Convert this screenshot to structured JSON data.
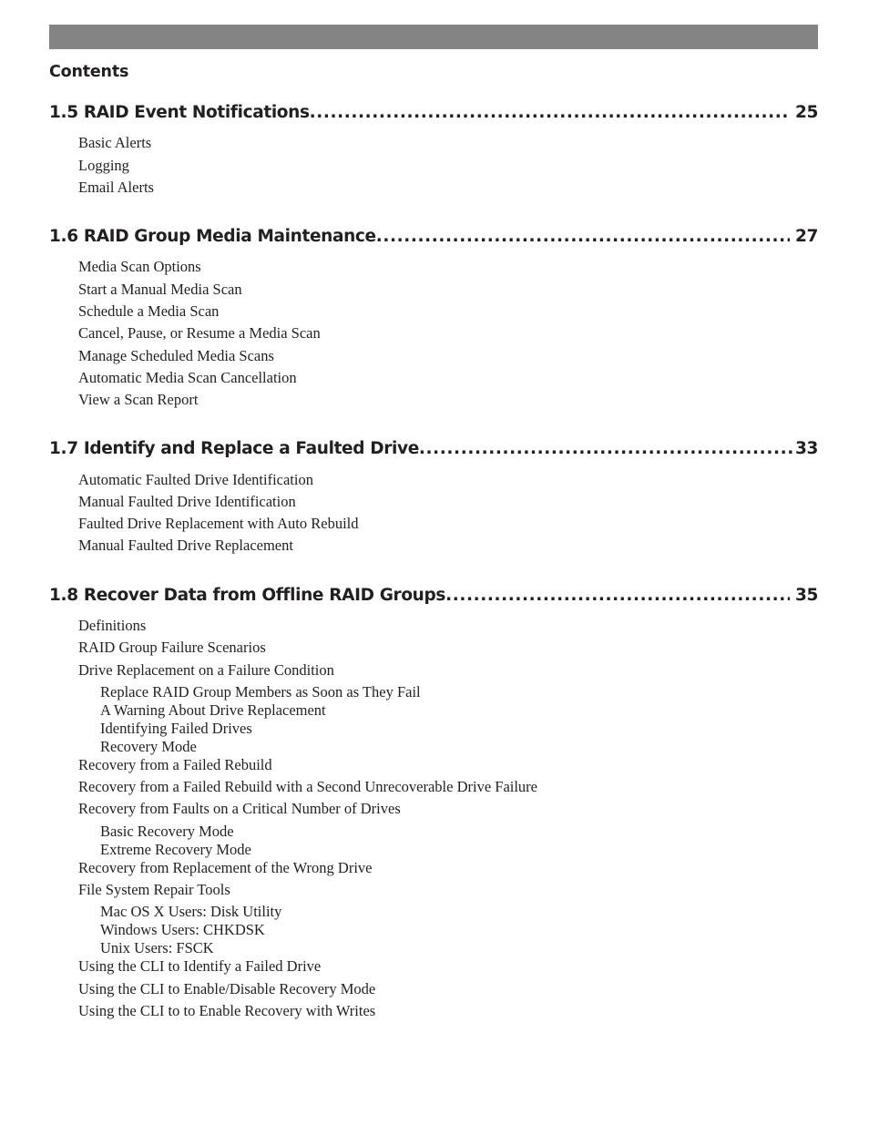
{
  "document": {
    "contents_heading": "Contents",
    "accent_bar_color": "#848484",
    "text_color": "#231f20"
  },
  "toc": {
    "sections": [
      {
        "label": "1.5 RAID Event Notifications",
        "page": "25",
        "leader_tight": false,
        "entries": [
          {
            "level": 2,
            "text": "Basic Alerts"
          },
          {
            "level": 2,
            "text": "Logging"
          },
          {
            "level": 2,
            "text": "Email Alerts"
          }
        ]
      },
      {
        "label": "1.6 RAID Group Media Maintenance",
        "page": "27",
        "leader_tight": false,
        "entries": [
          {
            "level": 2,
            "text": "Media Scan Options"
          },
          {
            "level": 2,
            "text": "Start a Manual Media Scan"
          },
          {
            "level": 2,
            "text": "Schedule a Media Scan"
          },
          {
            "level": 2,
            "text": "Cancel, Pause, or Resume a Media Scan"
          },
          {
            "level": 2,
            "text": "Manage Scheduled Media Scans"
          },
          {
            "level": 2,
            "text": "Automatic Media Scan Cancellation"
          },
          {
            "level": 2,
            "text": "View a Scan Report"
          }
        ]
      },
      {
        "label": "1.7 Identify and Replace a Faulted Drive",
        "page": "33",
        "leader_tight": true,
        "entries": [
          {
            "level": 2,
            "text": "Automatic Faulted Drive Identification"
          },
          {
            "level": 2,
            "text": "Manual Faulted Drive Identification"
          },
          {
            "level": 2,
            "text": "Faulted Drive Replacement with Auto Rebuild"
          },
          {
            "level": 2,
            "text": "Manual Faulted Drive Replacement"
          }
        ]
      },
      {
        "label": "1.8 Recover Data from Offline RAID Groups",
        "page": "35",
        "leader_tight": false,
        "entries": [
          {
            "level": 2,
            "text": "Definitions"
          },
          {
            "level": 2,
            "text": "RAID Group Failure Scenarios"
          },
          {
            "level": 2,
            "text": "Drive Replacement on a Failure Condition"
          },
          {
            "level": 3,
            "text": "Replace RAID Group Members as Soon as They Fail"
          },
          {
            "level": 3,
            "text": "A Warning About Drive Replacement"
          },
          {
            "level": 3,
            "text": "Identifying Failed Drives"
          },
          {
            "level": 3,
            "text": "Recovery Mode"
          },
          {
            "level": 2,
            "text": "Recovery from a Failed Rebuild"
          },
          {
            "level": 2,
            "text": "Recovery from a Failed Rebuild with a Second Unrecoverable Drive Failure"
          },
          {
            "level": 2,
            "text": "Recovery from Faults on a Critical Number of Drives"
          },
          {
            "level": 3,
            "text": "Basic Recovery Mode"
          },
          {
            "level": 3,
            "text": "Extreme Recovery Mode"
          },
          {
            "level": 2,
            "text": "Recovery from Replacement of the Wrong Drive"
          },
          {
            "level": 2,
            "text": "File System Repair Tools"
          },
          {
            "level": 3,
            "text": "Mac OS X Users: Disk Utility"
          },
          {
            "level": 3,
            "text": "Windows Users: CHKDSK"
          },
          {
            "level": 3,
            "text": "Unix Users: FSCK"
          },
          {
            "level": 2,
            "text": "Using the CLI to Identify a Failed Drive"
          },
          {
            "level": 2,
            "text": "Using the CLI to Enable/Disable Recovery Mode"
          },
          {
            "level": 2,
            "text": "Using the CLI to to Enable Recovery with Writes"
          }
        ]
      }
    ]
  }
}
